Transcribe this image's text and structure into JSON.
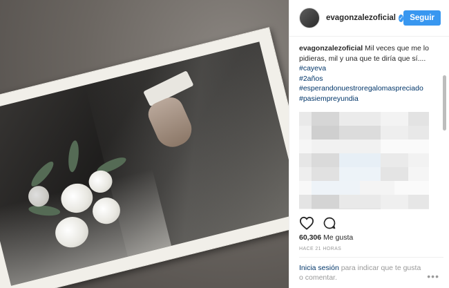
{
  "post": {
    "username": "evagonzalezoficial",
    "follow_label": "Seguir",
    "verified_icon": "check",
    "caption_text": "Mil veces que me lo pidieras, mil y una que te diría que sí....",
    "hashtags": [
      "#cayeva",
      "#2años",
      "#esperandonuestroregalomaspreciado",
      "#pasiempreyundia"
    ],
    "likes_count": "60,306",
    "likes_label": "Me gusta",
    "time_ago": "HACE 21 HORAS",
    "login_link": "Inicia sesión",
    "login_text": "para indicar que te gusta o comentar."
  },
  "colors": {
    "accent": "#3897f0",
    "hashtag": "#003569",
    "muted": "#999999"
  },
  "icons": {
    "like": "heart-icon",
    "comment": "comment-icon",
    "more": "more-icon"
  }
}
